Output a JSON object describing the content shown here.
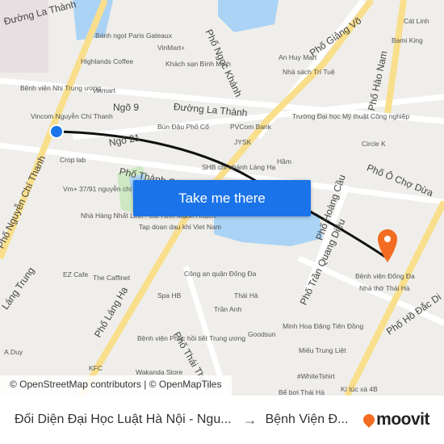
{
  "map": {
    "streets": [
      "Đường La Thành",
      "Phố Ngọc Khánh",
      "Phố Giảng Võ",
      "Ngõ 9",
      "Đường La Thành",
      "Ngõ 21",
      "Phố Thành Công",
      "Phố Nguyễn Chí Thanh",
      "Phố Láng Hạ",
      "Phố Hoàng Cầu",
      "Phố Trần Quang Diệu",
      "Phố Hào Nam",
      "Phố Ô Chợ Dừa",
      "Phố Thái Thịnh",
      "Phố Hồ Đắc Di",
      "Láng Trung"
    ],
    "places": [
      "Bánh ngọt Paris Gateaux",
      "Highlands Coffee",
      "VinMart+",
      "Khách sạn Bình Minh",
      "An Huy Mart",
      "Nhà sách Trí Tuệ",
      "Cát Linh",
      "Bami King",
      "Bệnh viện Nhi Trung ương",
      "Vincom Nguyễn Chí Thanh",
      "vinmart",
      "Bún Đậu Phố Cổ",
      "PVCom Bank",
      "Trường Đại học Mỹ thuật Công nghiệp",
      "JYSK",
      "Circle K",
      "Crop lab",
      "Vm+ 37/91 nguyễn chí thanh",
      "SHB chi nhánh Láng Hạ",
      "Hầm",
      "Nhà Hàng Nhất Linh - Gà Tươi Mạnh Hoạch",
      "Tap doan dau khi Viet Nam",
      "Công an quận Đống Đa",
      "EZ Cafe",
      "The Caffinet",
      "Spa HB",
      "Thái Hà",
      "Trần Anh",
      "Goodsun",
      "Minh Hoa Đăng Tiên Đồng",
      "Miếu Trung Liệt",
      "Bệnh viện Đống Đa",
      "Nhà thờ Thái Hà",
      "Bệnh viện Phục hồi tiết Trung ương",
      "Wakanda Store",
      "KFC",
      "#WhiteTshirt",
      "Bể bơi Thái Hà",
      "Kí túc xá 4B",
      "A.Duy"
    ],
    "route_color": "#111111",
    "water_color": "#aad3f5",
    "destination_marker_color": "#f26d21"
  },
  "cta": {
    "label": "Take me there"
  },
  "attribution": "© OpenStreetMap contributors | © OpenMapTiles",
  "footer": {
    "from": "Đối Diện Đại Học Luật Hà Nội - Ngu...",
    "arrow": "→",
    "to": "Bệnh Viện Đ...",
    "logo": "moovit",
    "brand_color": "#f26d21"
  }
}
